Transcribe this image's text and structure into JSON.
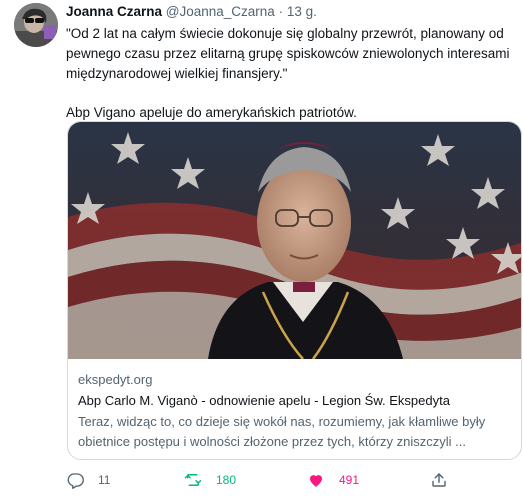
{
  "tweet": {
    "display_name": "Joanna Czarna",
    "handle": "@Joanna_Czarna",
    "separator": "·",
    "time": "13 g.",
    "text_paragraph_1": "\"Od 2 lat na całym świecie dokonuje się globalny przewrót, planowany od pewnego czasu przez elitarną grupę spiskowców zniewolonych interesami międzynarodowej wielkiej finansjery.\"",
    "text_paragraph_2": "Abp Vigano apeluje do amerykańskich patriotów."
  },
  "card": {
    "domain": "ekspedyt.org",
    "title": "Abp Carlo M. Viganò - odnowienie apelu - Legion Św. Ekspedyta",
    "description": "Teraz, widząc to, co dzieje się wokół nas, rozumiemy, jak kłamliwe były obietnice postępu i wolności złożone przez tych, którzy zniszczyli ..."
  },
  "actions": {
    "reply": {
      "icon": "reply-icon",
      "count": "11"
    },
    "retweet": {
      "icon": "retweet-icon",
      "count": "180",
      "color": "#00ba7c"
    },
    "like": {
      "icon": "heart-filled-icon",
      "count": "491",
      "color": "#f91880"
    },
    "share": {
      "icon": "share-icon"
    }
  },
  "colors": {
    "text_primary": "#0f1419",
    "text_secondary": "#536471",
    "border": "#cfd9de"
  }
}
